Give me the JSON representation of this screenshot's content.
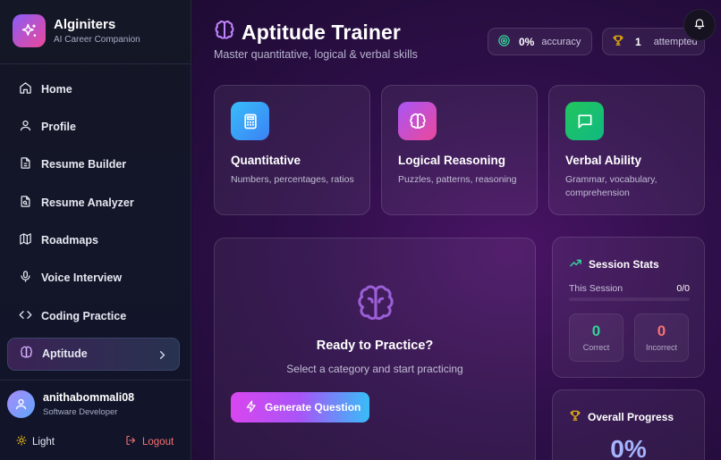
{
  "brand": {
    "name": "Alginiters",
    "tagline": "AI Career Companion"
  },
  "nav": [
    {
      "label": "Home",
      "icon": "home-icon"
    },
    {
      "label": "Profile",
      "icon": "user-icon"
    },
    {
      "label": "Resume Builder",
      "icon": "file-icon"
    },
    {
      "label": "Resume Analyzer",
      "icon": "file-search-icon"
    },
    {
      "label": "Roadmaps",
      "icon": "map-icon"
    },
    {
      "label": "Voice Interview",
      "icon": "mic-icon"
    },
    {
      "label": "Coding Practice",
      "icon": "code-icon"
    },
    {
      "label": "Aptitude",
      "icon": "brain-icon",
      "active": true
    }
  ],
  "user": {
    "name": "anithabommali08",
    "role": "Software Developer"
  },
  "footer": {
    "theme_label": "Light",
    "logout_label": "Logout"
  },
  "header": {
    "title": "Aptitude Trainer",
    "subtitle": "Master quantitative, logical & verbal skills",
    "accuracy_value": "0%",
    "accuracy_label": "accuracy",
    "attempted_value": "1",
    "attempted_label": "attempted"
  },
  "categories": [
    {
      "title": "Quantitative",
      "desc": "Numbers, percentages, ratios",
      "icon": "calculator-icon",
      "color": "#38bdf8"
    },
    {
      "title": "Logical Reasoning",
      "desc": "Puzzles, patterns, reasoning",
      "icon": "brain-icon",
      "color": "#c026d3"
    },
    {
      "title": "Verbal Ability",
      "desc": "Grammar, vocabulary, comprehension",
      "icon": "message-icon",
      "color": "#22c55e"
    }
  ],
  "practice": {
    "title": "Ready to Practice?",
    "subtitle": "Select a category and start practicing",
    "button_label": "Generate Question"
  },
  "session_stats": {
    "title": "Session Stats",
    "session_label": "This Session",
    "session_value": "0/0",
    "correct_value": "0",
    "correct_label": "Correct",
    "incorrect_value": "0",
    "incorrect_label": "Incorrect"
  },
  "overall": {
    "title": "Overall Progress",
    "value": "0%"
  },
  "colors": {
    "accent": "#a855f7",
    "correct": "#34d399",
    "incorrect": "#f87171",
    "gold": "#eab308"
  }
}
